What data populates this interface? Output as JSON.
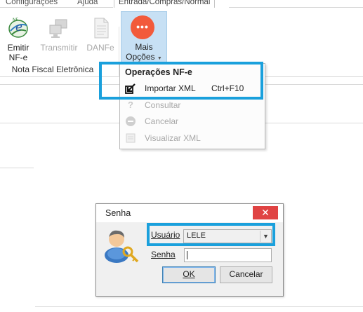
{
  "tabs": [
    {
      "label": "Configurações",
      "active": false
    },
    {
      "label": "Ajuda",
      "active": false
    },
    {
      "label": "Entrada/Compras/Normal",
      "active": true
    }
  ],
  "ribbon": {
    "buttons": [
      {
        "line1": "Emitir",
        "line2": "NF-e",
        "enabled": true,
        "icon": "nfe-logo-icon"
      },
      {
        "line1": "Transmitir",
        "line2": "",
        "enabled": false,
        "icon": "computers-icon"
      },
      {
        "line1": "DANFe",
        "line2": "",
        "enabled": false,
        "icon": "document-icon"
      }
    ],
    "group_label": "Nota Fiscal Eletrônica",
    "mais_opcoes": {
      "line1": "Mais",
      "line2": "Opções",
      "dots": "•••"
    }
  },
  "menu": {
    "header": "Operações NF-e",
    "items": [
      {
        "label": "Importar XML",
        "shortcut": "Ctrl+F10",
        "enabled": true,
        "icon": "import-icon"
      },
      {
        "label": "Consultar",
        "shortcut": "",
        "enabled": false,
        "icon": "question-icon"
      },
      {
        "label": "Cancelar",
        "shortcut": "",
        "enabled": false,
        "icon": "cancel-icon"
      },
      {
        "label": "Visualizar XML",
        "shortcut": "",
        "enabled": false,
        "icon": "view-xml-icon"
      }
    ]
  },
  "dialog": {
    "title": "Senha",
    "close_glyph": "✕",
    "user_label": "Usuário",
    "user_value": "LELE",
    "password_label": "Senha",
    "password_value": "",
    "ok_label": "OK",
    "cancel_label": "Cancelar"
  },
  "colors": {
    "highlight": "#1aa0dc",
    "accent_orange": "#f25a3b",
    "selected_ribbon": "#c7e0f4",
    "close_red": "#e04343"
  }
}
